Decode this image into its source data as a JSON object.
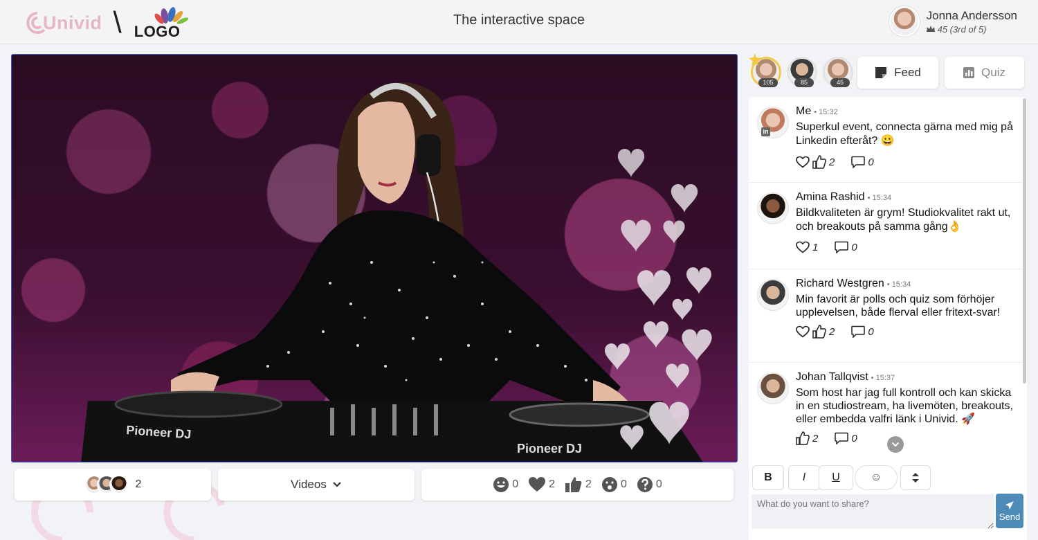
{
  "header": {
    "brand": "Univid",
    "logo_text": "LOGO",
    "title": "The interactive space",
    "user": {
      "name": "Jonna Andersson",
      "score": "45 (3rd of 5)"
    }
  },
  "bottom_bar": {
    "participants_count": "2",
    "videos_label": "Videos",
    "reactions": [
      {
        "icon": "smile-icon",
        "count": "0"
      },
      {
        "icon": "heart-icon",
        "count": "2"
      },
      {
        "icon": "thumbs-up-icon",
        "count": "2"
      },
      {
        "icon": "surprised-icon",
        "count": "0"
      },
      {
        "icon": "question-icon",
        "count": "0"
      }
    ]
  },
  "leaderboard": [
    {
      "points": "105"
    },
    {
      "points": "85"
    },
    {
      "points": "45"
    }
  ],
  "tabs": {
    "feed": "Feed",
    "quiz": "Quiz"
  },
  "posts": [
    {
      "name": "Me",
      "time": "15:32",
      "text": "Superkul event, connecta gärna med mig på Linkedin efteråt? 😀",
      "likes": "2",
      "comments": "0"
    },
    {
      "name": "Amina Rashid",
      "time": "15:34",
      "text": "Bildkvaliteten är grym! Studiokvalitet rakt ut, och breakouts på samma gång👌",
      "likes": "1",
      "comments": "0"
    },
    {
      "name": "Richard Westgren",
      "time": "15:34",
      "text": "Min favorit är polls och quiz som förhöjer upplevelsen, både flerval eller fritext-svar!",
      "likes": "2",
      "comments": "0"
    },
    {
      "name": "Johan Tallqvist",
      "time": "15:37",
      "text": "Som host har jag full kontroll och kan skicka in en studiostream, ha livemöten, breakouts, eller embedda valfri länk i Univid. 🚀",
      "likes": "2",
      "comments": "0"
    }
  ],
  "composer": {
    "bold": "B",
    "italic": "I",
    "underline": "U",
    "emoji": "☺",
    "placeholder": "What do you want to share?",
    "send": "Send"
  },
  "colors": {
    "accent": "#4f8bb8",
    "brand": "#e5b6ca",
    "video_border": "#3a57c4"
  }
}
